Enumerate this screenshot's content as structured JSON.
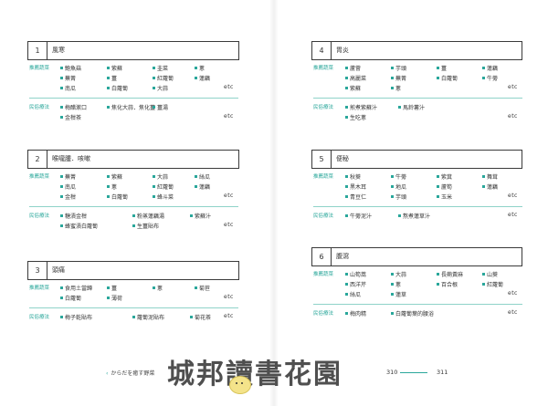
{
  "labels": {
    "veg": "推薦蔬菜",
    "folk": "民俗療法",
    "etc": "etc"
  },
  "left_sections": [
    {
      "num": "1",
      "title": "風寒",
      "veg": [
        "鮑魚菇",
        "紫蘇",
        "韭菜",
        "蔥",
        "蕪菁",
        "薑",
        "紅蘿蔔",
        "蓮藕",
        "南瓜",
        "白蘿蔔",
        "大蒜"
      ],
      "folk": [
        "梅醋漱口",
        "焦化大蒜．焦化薑",
        "薑湯",
        "金柑茶"
      ]
    },
    {
      "num": "2",
      "title": "喉嚨腫．咳嗽",
      "veg": [
        "蕪菁",
        "紫蘇",
        "大蒜",
        "絲瓜",
        "南瓜",
        "蔥",
        "紅蘿蔔",
        "蓮藕",
        "金柑",
        "白蘿蔔",
        "蜂斗菜"
      ],
      "folk": [
        "糖漬金柑",
        "粉蒸蓮藕湯",
        "紫蘇汁",
        "蜂蜜漬白蘿蔔",
        "生薑貼布"
      ]
    },
    {
      "num": "3",
      "title": "頭痛",
      "veg": [
        "食用土當歸",
        "薑",
        "蔥",
        "菊苣",
        "白蘿蔔",
        "薄荷"
      ],
      "folk": [
        "梅子乾貼布",
        "蘿蔔泥貼布",
        "菊花茶"
      ]
    }
  ],
  "right_sections": [
    {
      "num": "4",
      "title": "胃炎",
      "veg": [
        "蘆薈",
        "芋頭",
        "薑",
        "蓮藕",
        "高麗菜",
        "蕪菁",
        "白蘿蔔",
        "牛蒡",
        "紫蘇",
        "蔥"
      ],
      "folk": [
        "煎煮紫蘇汁",
        "馬鈴薯汁",
        "生吃蔥"
      ]
    },
    {
      "num": "5",
      "title": "便秘",
      "veg": [
        "秋葵",
        "牛蒡",
        "紫萁",
        "舞茸",
        "黑木耳",
        "地瓜",
        "蘆筍",
        "蓮藕",
        "青豆仁",
        "芋頭",
        "玉米"
      ],
      "folk": [
        "牛蒡泥汁",
        "熬煮蓮草汁"
      ]
    },
    {
      "num": "6",
      "title": "腹瀉",
      "veg": [
        "山筍蒿",
        "大蒜",
        "長蒴黃麻",
        "山葵",
        "西洋芹",
        "蔥",
        "百合根",
        "紅蘿蔔",
        "絲瓜",
        "蓮草"
      ],
      "folk": [
        "梅肉精",
        "白蘿蔔葉的腰浴"
      ]
    }
  ],
  "footer": {
    "book_title": "からだを癒す野菜",
    "page_left": "310",
    "page_right": "311",
    "watermark": "城邦讀書花園"
  },
  "colors": {
    "accent": "#2aa79b",
    "separator": "#8fd3c9"
  }
}
